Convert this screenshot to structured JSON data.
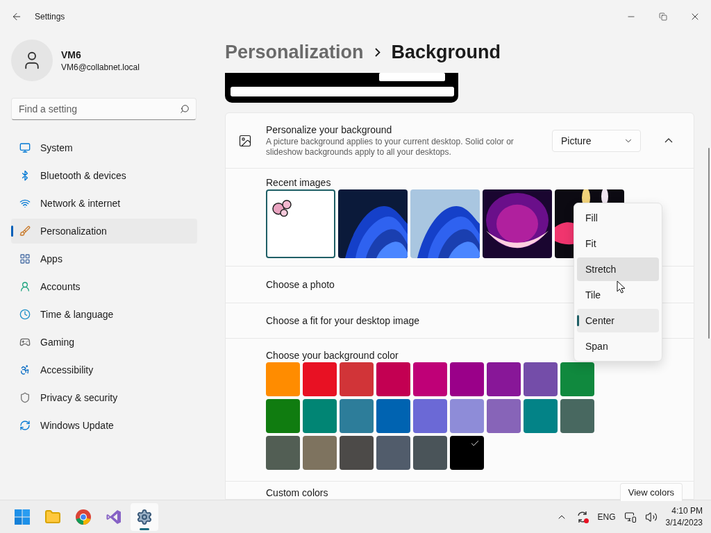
{
  "window": {
    "title": "Settings"
  },
  "user": {
    "name": "VM6",
    "email": "VM6@collabnet.local"
  },
  "search": {
    "placeholder": "Find a setting"
  },
  "nav": [
    {
      "label": "System",
      "selected": false
    },
    {
      "label": "Bluetooth & devices",
      "selected": false
    },
    {
      "label": "Network & internet",
      "selected": false
    },
    {
      "label": "Personalization",
      "selected": true
    },
    {
      "label": "Apps",
      "selected": false
    },
    {
      "label": "Accounts",
      "selected": false
    },
    {
      "label": "Time & language",
      "selected": false
    },
    {
      "label": "Gaming",
      "selected": false
    },
    {
      "label": "Accessibility",
      "selected": false
    },
    {
      "label": "Privacy & security",
      "selected": false
    },
    {
      "label": "Windows Update",
      "selected": false
    }
  ],
  "breadcrumb": {
    "parent": "Personalization",
    "current": "Background"
  },
  "background_card": {
    "title": "Personalize your background",
    "description": "A picture background applies to your current desktop. Solid color or slideshow backgrounds apply to all your desktops.",
    "mode": "Picture",
    "expanded": true
  },
  "recent_images": {
    "label": "Recent images",
    "images": [
      {
        "kind": "picture",
        "selected": true
      },
      {
        "kind": "picture",
        "selected": false
      },
      {
        "kind": "picture",
        "selected": false
      },
      {
        "kind": "picture",
        "selected": false
      },
      {
        "kind": "picture",
        "selected": false
      }
    ]
  },
  "choose_photo": {
    "label": "Choose a photo"
  },
  "choose_fit": {
    "label": "Choose a fit for your desktop image"
  },
  "fit_menu": {
    "options": [
      {
        "label": "Fill",
        "selected": false,
        "hovered": false
      },
      {
        "label": "Fit",
        "selected": false,
        "hovered": false
      },
      {
        "label": "Stretch",
        "selected": false,
        "hovered": true
      },
      {
        "label": "Tile",
        "selected": false,
        "hovered": false
      },
      {
        "label": "Center",
        "selected": true,
        "hovered": false
      },
      {
        "label": "Span",
        "selected": false,
        "hovered": false
      }
    ]
  },
  "background_color": {
    "label": "Choose your background color",
    "swatches": [
      {
        "color": "#ff8c00",
        "selected": false
      },
      {
        "color": "#e81123",
        "selected": false
      },
      {
        "color": "#d13438",
        "selected": false
      },
      {
        "color": "#c30052",
        "selected": false
      },
      {
        "color": "#bf0077",
        "selected": false
      },
      {
        "color": "#9a0089",
        "selected": false
      },
      {
        "color": "#881798",
        "selected": false
      },
      {
        "color": "#744da9",
        "selected": false
      },
      {
        "color": "#10893e",
        "selected": false
      },
      {
        "color": "#107c10",
        "selected": false
      },
      {
        "color": "#018574",
        "selected": false
      },
      {
        "color": "#2d7d9a",
        "selected": false
      },
      {
        "color": "#0063b1",
        "selected": false
      },
      {
        "color": "#6b69d6",
        "selected": false
      },
      {
        "color": "#8e8cd8",
        "selected": false
      },
      {
        "color": "#8764b8",
        "selected": false
      },
      {
        "color": "#038387",
        "selected": false
      },
      {
        "color": "#486860",
        "selected": false
      },
      {
        "color": "#525e54",
        "selected": false
      },
      {
        "color": "#7e735f",
        "selected": false
      },
      {
        "color": "#4c4a48",
        "selected": false
      },
      {
        "color": "#515c6b",
        "selected": false
      },
      {
        "color": "#4a5459",
        "selected": false
      },
      {
        "color": "#000000",
        "selected": true
      }
    ]
  },
  "custom_colors": {
    "label": "Custom colors",
    "button": "View colors"
  },
  "taskbar": {
    "apps": [
      {
        "selected": false
      },
      {
        "selected": false
      },
      {
        "selected": false
      },
      {
        "selected": false
      },
      {
        "selected": true
      }
    ],
    "language": "ENG",
    "time": "4:10 PM",
    "date": "3/14/2023"
  }
}
